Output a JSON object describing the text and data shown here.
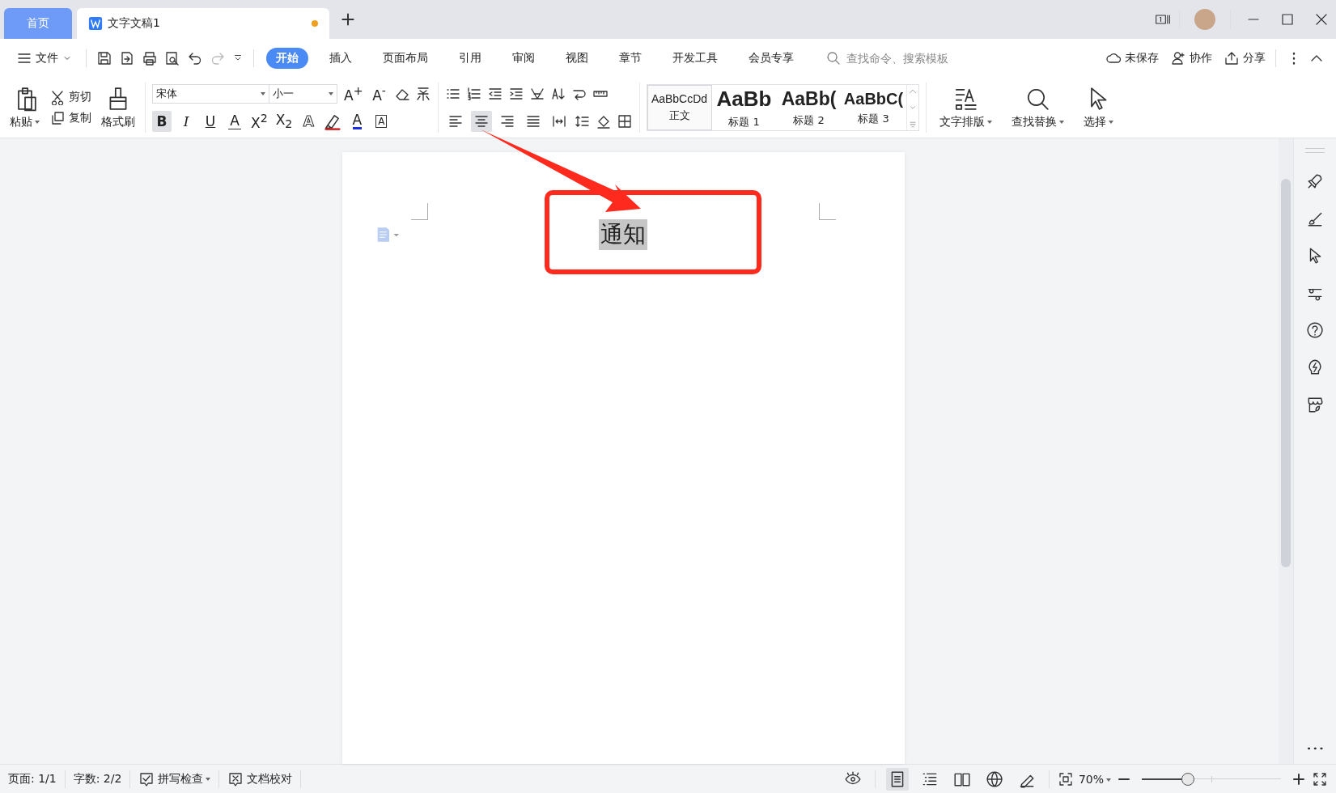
{
  "tabs": [
    {
      "label": "首页",
      "kind": "home",
      "selected": false
    },
    {
      "label": "文字文稿1",
      "kind": "document",
      "selected": true,
      "unsaved": true
    }
  ],
  "menu": {
    "file": "文件",
    "ribbon_tabs": [
      {
        "label": "开始",
        "selected": true
      },
      {
        "label": "插入",
        "selected": false
      },
      {
        "label": "页面布局",
        "selected": false
      },
      {
        "label": "引用",
        "selected": false
      },
      {
        "label": "审阅",
        "selected": false
      },
      {
        "label": "视图",
        "selected": false
      },
      {
        "label": "章节",
        "selected": false
      },
      {
        "label": "开发工具",
        "selected": false
      },
      {
        "label": "会员专享",
        "selected": false
      }
    ],
    "search": {
      "placeholder": "查找命令、搜索模板"
    },
    "actions": [
      {
        "label": "未保存",
        "kind": "cloud"
      },
      {
        "label": "协作",
        "kind": "user"
      },
      {
        "label": "分享",
        "kind": "share"
      }
    ]
  },
  "ribbon": {
    "paste": "粘贴",
    "cut": "剪切",
    "copy": "复制",
    "format_painter": "格式刷",
    "font_name": "宋体",
    "font_size": "小一",
    "size_buttons": [
      "A$^{+}$",
      "A$^{-}$"
    ],
    "format_buttons": [
      {
        "kind": "bold",
        "label": "B",
        "selected": true
      },
      {
        "kind": "italic",
        "label": "I",
        "selected": false
      },
      {
        "kind": "underline",
        "label": "U",
        "selected": false
      },
      {
        "kind": "strike",
        "label": "A",
        "selected": false
      },
      {
        "kind": "plain",
        "label": "X$^{2}$",
        "selected": false
      },
      {
        "kind": "plain",
        "label": "X$_{2}$",
        "selected": false
      },
      {
        "kind": "effect",
        "label": "A",
        "selected": false
      },
      {
        "kind": "highlight",
        "selected": false
      },
      {
        "kind": "color",
        "label": "A",
        "selected": false
      },
      {
        "kind": "border",
        "label": "A",
        "selected": false
      }
    ],
    "alignments": [
      {
        "kind": "left",
        "selected": false
      },
      {
        "kind": "center",
        "selected": true
      },
      {
        "kind": "right",
        "selected": false
      },
      {
        "kind": "justify",
        "selected": false
      },
      {
        "kind": "distributed",
        "selected": false
      }
    ],
    "styles": [
      {
        "preview": "AaBbCcDd",
        "label": "正文",
        "kind": "normal",
        "selected": true
      },
      {
        "preview": "AaBb",
        "label": "标题 1",
        "kind": "h1",
        "selected": false
      },
      {
        "preview": "AaBb(",
        "label": "标题 2",
        "kind": "h2",
        "selected": false
      },
      {
        "preview": "AaBbC(",
        "label": "标题 3",
        "kind": "h3",
        "selected": false
      }
    ],
    "big_buttons": [
      {
        "label": "文字排版",
        "kind": "layout"
      },
      {
        "label": "查找替换",
        "kind": "find"
      },
      {
        "label": "选择",
        "kind": "select"
      }
    ]
  },
  "document": {
    "title": "通知",
    "highlighted": true
  },
  "status_bar": {
    "page": "页面: 1/1",
    "words": "字数: 2/2",
    "spell_check": "拼写检查",
    "proofread": "文档校对",
    "views": [
      {
        "kind": "eye",
        "selected": false
      },
      {
        "kind": "page",
        "selected": true
      },
      {
        "kind": "outline",
        "selected": false
      },
      {
        "kind": "read",
        "selected": false
      },
      {
        "kind": "web",
        "selected": false
      },
      {
        "kind": "pen",
        "selected": false
      }
    ],
    "zoom": "70%",
    "zoom_slider": {
      "level": 0.33
    }
  }
}
